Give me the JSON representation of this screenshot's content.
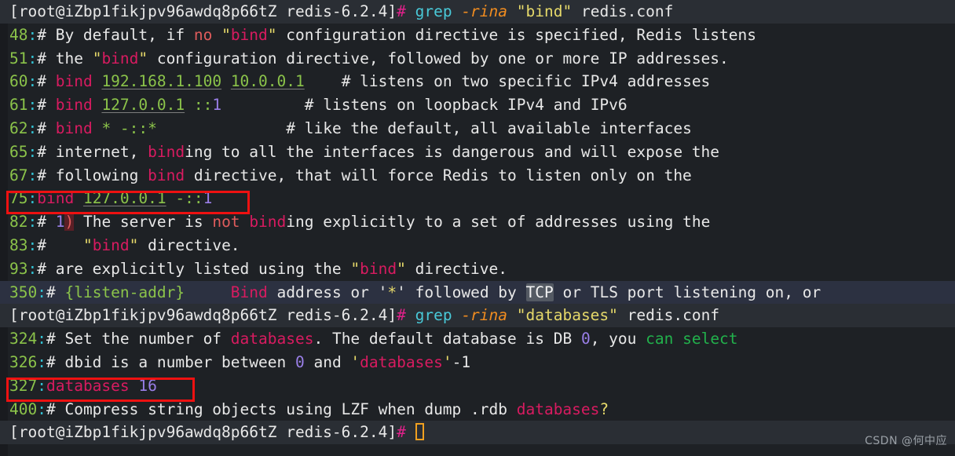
{
  "terminal": {
    "title": "redis.conf grep session",
    "colors": {
      "background": "#1e2125",
      "prompt_row_background": "#2a2e34",
      "highlight_row_background": "#2c3141",
      "line_number": "#8bc34a",
      "match": "#d81b60",
      "number_literal": "#9a7fe8",
      "string": "#e6d96a",
      "option_flag": "#f08c20",
      "command": "#49c9d8",
      "box_outline": "#ee1111",
      "cursor_outline": "#f0a020"
    },
    "prompt": {
      "user_host_path": "[root@iZbp1fikjpv96awdq8p66tZ redis-6.2.4]",
      "symbol": "#"
    },
    "commands": [
      {
        "name": "grep",
        "flags": "-rina",
        "pattern": "\"bind\"",
        "file": "redis.conf"
      },
      {
        "name": "grep",
        "flags": "-rina",
        "pattern": "\"databases\"",
        "file": "redis.conf"
      }
    ],
    "results_bind": [
      {
        "line": "48",
        "sep": ":",
        "text": "# By default, if no \"bind\" configuration directive is specified, Redis listens"
      },
      {
        "line": "51",
        "sep": ":",
        "text": "# the \"bind\" configuration directive, followed by one or more IP addresses."
      },
      {
        "line": "60",
        "sep": ":",
        "text": "# bind 192.168.1.100 10.0.0.1    # listens on two specific IPv4 addresses"
      },
      {
        "line": "61",
        "sep": ":",
        "text": "# bind 127.0.0.1 ::1            # listens on loopback IPv4 and IPv6"
      },
      {
        "line": "62",
        "sep": ":",
        "text": "# bind * -::*                   # like the default, all available interfaces"
      },
      {
        "line": "65",
        "sep": ":",
        "text": "# internet, binding to all the interfaces is dangerous and will expose the"
      },
      {
        "line": "67",
        "sep": ":",
        "text": "# following bind directive, that will force Redis to listen only on the"
      },
      {
        "line": "75",
        "sep": ":",
        "text": "bind 127.0.0.1 -::1",
        "boxed": true
      },
      {
        "line": "82",
        "sep": ":",
        "text": "# 1) The server is not binding explicitly to a set of addresses using the"
      },
      {
        "line": "83",
        "sep": ":",
        "text": "#    \"bind\" directive."
      },
      {
        "line": "93",
        "sep": ":",
        "text": "# are explicitly listed using the \"bind\" directive."
      },
      {
        "line": "350",
        "sep": ":",
        "text": "# {listen-addr}     Bind address or '*' followed by TCP or TLS port listening on, or",
        "row_highlight": true
      }
    ],
    "results_databases": [
      {
        "line": "324",
        "sep": ":",
        "text": "# Set the number of databases. The default database is DB 0, you can select"
      },
      {
        "line": "326",
        "sep": ":",
        "text": "# dbid is a number between 0 and 'databases'-1"
      },
      {
        "line": "327",
        "sep": ":",
        "text": "databases 16",
        "boxed": true
      },
      {
        "line": "400",
        "sep": ":",
        "text": "# Compress string objects using LZF when dump .rdb databases?"
      }
    ],
    "cursor": {
      "shape": "hollow-block"
    },
    "watermark": "CSDN @何中应"
  }
}
